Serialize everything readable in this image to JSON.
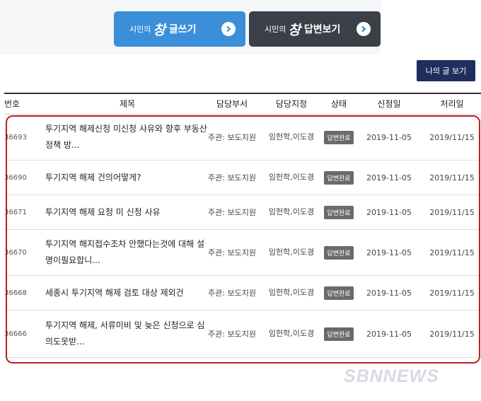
{
  "tabs": {
    "write": {
      "prefix": "시민의",
      "logo": "창",
      "label": "글쓰기"
    },
    "answer": {
      "prefix": "시민의",
      "logo": "창",
      "label": "답변보기"
    }
  },
  "my_posts_button": "나의 글 보기",
  "table": {
    "headers": {
      "num": "번호",
      "title": "제목",
      "dept": "담당부서",
      "staff": "담당지정",
      "status": "상태",
      "requested": "신청일",
      "processed": "처리일"
    },
    "rows": [
      {
        "num": "36693",
        "title": "투기지역 해제신청 미신청 사유와 향후 부동산 정책 방...",
        "dept": "주관: 보도지원",
        "staff": "임헌학,이도경",
        "status": "답변완료",
        "requested": "2019-11-05",
        "processed": "2019/11/15"
      },
      {
        "num": "36690",
        "title": "투기지역 해제 건의어떻게?",
        "dept": "주관: 보도지원",
        "staff": "임헌학,이도경",
        "status": "답변완료",
        "requested": "2019-11-05",
        "processed": "2019/11/15"
      },
      {
        "num": "36671",
        "title": "투기지역 해제 요청 미 신청 사유",
        "dept": "주관: 보도지원",
        "staff": "임헌학,이도경",
        "status": "답변완료",
        "requested": "2019-11-05",
        "processed": "2019/11/15"
      },
      {
        "num": "36670",
        "title": "투기지역 해지접수조차 안했다는것에 대해 설명이필요합니...",
        "dept": "주관: 보도지원",
        "staff": "임헌학,이도경",
        "status": "답변완료",
        "requested": "2019-11-05",
        "processed": "2019/11/15"
      },
      {
        "num": "36668",
        "title": "세종시 투기지역 해제 검토 대상 제외건",
        "dept": "주관: 보도지원",
        "staff": "임헌학,이도경",
        "status": "답변완료",
        "requested": "2019-11-05",
        "processed": "2019/11/15"
      },
      {
        "num": "36666",
        "title": "투기지역 해제, 서류미비 및 늦은 신청으로 심의도못받...",
        "dept": "주관: 보도지원",
        "staff": "임헌학,이도경",
        "status": "답변완료",
        "requested": "2019-11-05",
        "processed": "2019/11/15"
      }
    ]
  },
  "watermark": "SBNNEWS",
  "colors": {
    "write_tab": "#3b8fd8",
    "answer_tab": "#3b4048",
    "my_posts": "#1e2f5e",
    "highlight": "#c01d1d",
    "badge": "#6a6a6a"
  }
}
